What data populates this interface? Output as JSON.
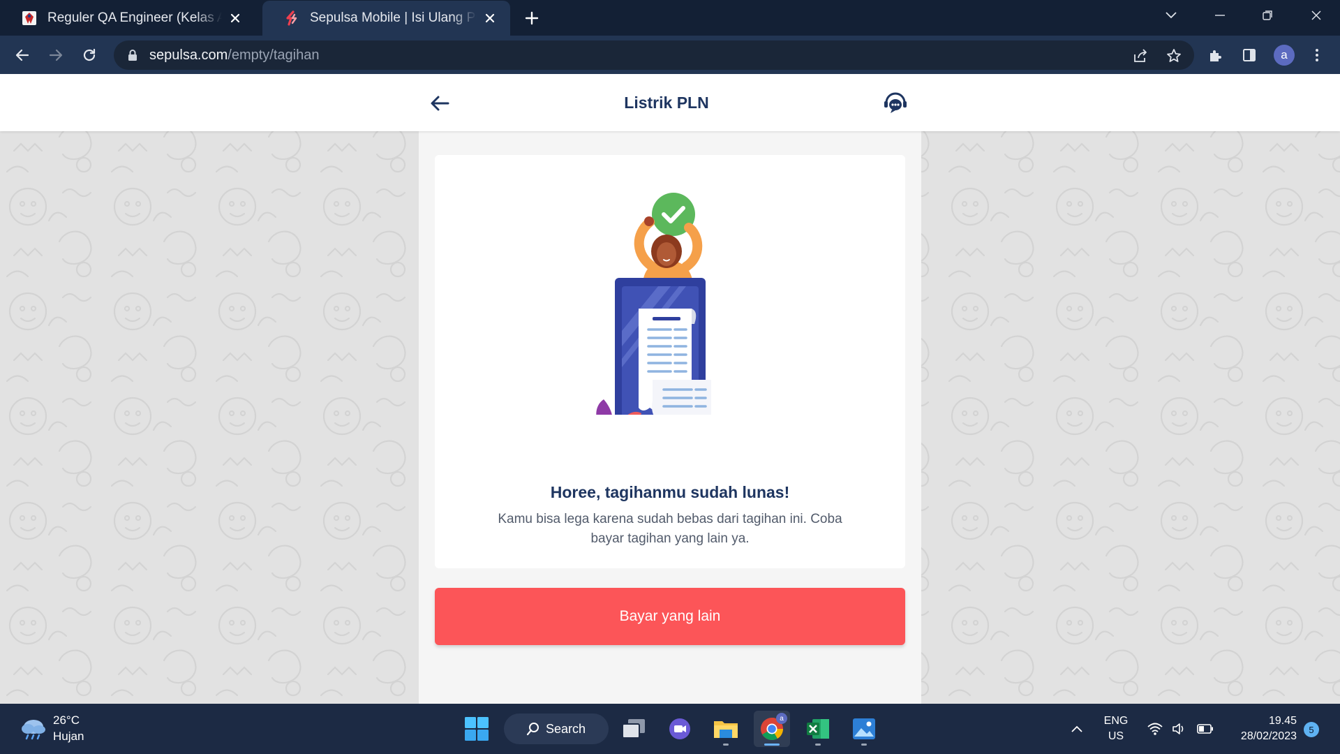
{
  "browser": {
    "tabs": [
      {
        "title": "Reguler QA Engineer (Kelas A, B, C)",
        "active": false,
        "favicon": "university-logo-icon"
      },
      {
        "title": "Sepulsa Mobile | Isi Ulang Pulsa Sepulsa",
        "active": true,
        "favicon": "sepulsa-logo-icon"
      }
    ],
    "url_host": "sepulsa.com",
    "url_path": "/empty/tagihan",
    "profile_initial": "a"
  },
  "header": {
    "title": "Listrik PLN"
  },
  "card": {
    "heading": "Horee, tagihanmu sudah lunas!",
    "description": "Kamu bisa lega karena sudah bebas dari tagihan ini. Coba bayar tagihan yang lain ya."
  },
  "cta": {
    "label": "Bayar yang lain"
  },
  "colors": {
    "brand_red": "#fc5558",
    "title_navy": "#1e3560",
    "success_green": "#5cb85c"
  },
  "taskbar": {
    "weather_temp": "26°C",
    "weather_desc": "Hujan",
    "search_label": "Search",
    "lang_top": "ENG",
    "lang_bottom": "US",
    "time": "19.45",
    "date": "28/02/2023",
    "notifications": "5"
  }
}
